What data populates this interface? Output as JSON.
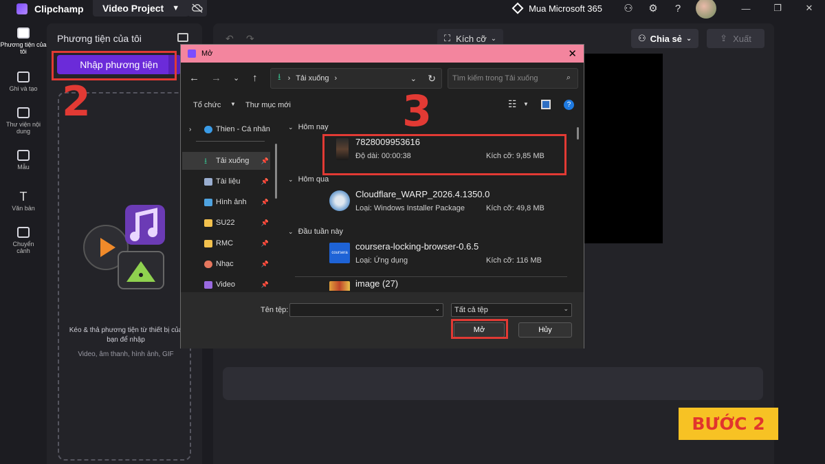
{
  "app": {
    "name": "Clipchamp",
    "project_label": "Video Project",
    "ms365_label": "Mua Microsoft 365",
    "brand_color": "#7c4dff"
  },
  "rail": {
    "items": [
      {
        "label": "Phương tiện của tôi",
        "icon": "folder-icon"
      },
      {
        "label": "Ghi và tạo",
        "icon": "camera-icon"
      },
      {
        "label": "Thư viện nội dung",
        "icon": "library-icon"
      },
      {
        "label": "Mẫu",
        "icon": "templates-icon"
      },
      {
        "label": "Văn bản",
        "icon": "text-icon"
      },
      {
        "label": "Chuyển cảnh",
        "icon": "transition-icon"
      }
    ]
  },
  "media_panel": {
    "title": "Phương tiện của tôi",
    "import_label": "Nhập phương tiện",
    "drop_title": "Kéo & thả phương tiện từ thiết bị của bạn để nhập",
    "drop_subtitle": "Video, âm thanh, hình ảnh, GIF"
  },
  "editor": {
    "size_label": "Kích cỡ",
    "share_label": "Chia sẻ",
    "export_label": "Xuất"
  },
  "annotations": {
    "step2": "2",
    "step3": "3",
    "badge": "BƯỚC 2",
    "marker_color": "#e23a34",
    "badge_color": "#f7c224"
  },
  "dialog": {
    "title": "Mở",
    "address": "Tải xuống",
    "search_placeholder": "Tìm kiếm trong Tải xuống",
    "organize_label": "Tổ chức",
    "new_folder_label": "Thư mục mới",
    "nav": [
      {
        "label": "Thien - Cá nhân",
        "icon": "onedrive-icon",
        "color": "#3a9be6"
      },
      {
        "label": "Tải xuống",
        "icon": "download-icon",
        "color": "#38b487",
        "pinned": true
      },
      {
        "label": "Tài liệu",
        "icon": "documents-icon",
        "color": "#9aaed0",
        "pinned": true
      },
      {
        "label": "Hình ảnh",
        "icon": "pictures-icon",
        "color": "#4fa3e0",
        "pinned": true
      },
      {
        "label": "SU22",
        "icon": "folder-icon",
        "color": "#f2c14e",
        "pinned": true
      },
      {
        "label": "RMC",
        "icon": "folder-icon",
        "color": "#f2c14e",
        "pinned": true
      },
      {
        "label": "Nhạc",
        "icon": "music-icon",
        "color": "#e5775e",
        "pinned": true
      },
      {
        "label": "Video",
        "icon": "video-icon",
        "color": "#9a6ae0",
        "pinned": true
      }
    ],
    "groups": [
      {
        "label": "Hôm nay"
      },
      {
        "label": "Hôm qua"
      },
      {
        "label": "Đầu tuần này"
      }
    ],
    "files": [
      {
        "name": "7828009953616",
        "meta": "Độ dài: 00:00:38",
        "size": "Kích cỡ: 9,85 MB",
        "icon": "video-thumbnail"
      },
      {
        "name": "Cloudflare_WARP_2026.4.1350.0",
        "meta": "Loại: Windows Installer Package",
        "size": "Kích cỡ: 49,8 MB",
        "icon": "installer-icon"
      },
      {
        "name": "coursera-locking-browser-0.6.5",
        "meta": "Loại: Ứng dụng",
        "size": "Kích cỡ: 116 MB",
        "icon": "coursera-icon",
        "icon_text": "coursera"
      },
      {
        "name": "image (27)",
        "meta": "",
        "size": "",
        "icon": "image-thumbnail"
      }
    ],
    "filename_label": "Tên tệp:",
    "filename_value": "",
    "filetype_value": "Tất cả tệp",
    "open_label": "Mở",
    "cancel_label": "Hủy"
  }
}
